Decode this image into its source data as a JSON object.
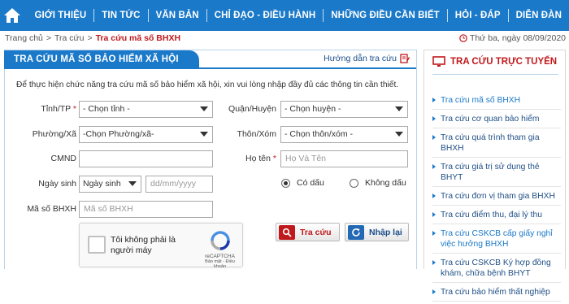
{
  "nav": {
    "items": [
      "GIỚI THIỆU",
      "TIN TỨC",
      "VĂN BẢN",
      "CHỈ ĐẠO - ĐIỀU HÀNH",
      "NHỮNG ĐIỀU CẦN BIẾT",
      "HỎI - ĐÁP",
      "DIỄN ĐÀN"
    ]
  },
  "breadcrumb": {
    "home": "Trang chủ",
    "parent": "Tra cứu",
    "current": "Tra cứu mã số BHXH"
  },
  "date_text": "Thứ ba, ngày 08/09/2020",
  "panel": {
    "title": "TRA CỨU MÃ SỐ BẢO HIỂM XÃ HỘI",
    "guide_label": "Hướng dẫn tra cứu",
    "intro": "Để thực hiện chức năng tra cứu mã số bảo hiểm xã hội, xin vui lòng nhập đầy đủ các thông tin cần thiết."
  },
  "form": {
    "province_label": "Tỉnh/TP",
    "province_value": "- Chọn tỉnh -",
    "district_label": "Quận/Huyện",
    "district_value": "- Chọn huyện -",
    "ward_label": "Phường/Xã",
    "ward_value": "-Chọn Phường/xã-",
    "village_label": "Thôn/Xóm",
    "village_value": "- Chọn thôn/xóm -",
    "cmnd_label": "CMND",
    "cmnd_value": "",
    "name_label": "Họ tên",
    "name_placeholder": "Họ Và Tên",
    "dob_label": "Ngày sinh",
    "dob_type_value": "Ngày sinh",
    "dob_placeholder": "dd/mm/yyyy",
    "accent_on": "Có dấu",
    "accent_off": "Không dấu",
    "bhxh_label": "Mã số BHXH",
    "bhxh_placeholder": "Mã số BHXH",
    "required_mark": "*"
  },
  "captcha": {
    "text": "Tôi không phải là người máy",
    "brand": "reCAPTCHA",
    "terms": "Bảo mật - Điều khoản"
  },
  "buttons": {
    "search": "Tra cứu",
    "reset": "Nhập lại"
  },
  "sidebar": {
    "title": "TRA CỨU TRỰC TUYẾN",
    "items": [
      "Tra cứu mã số BHXH",
      "Tra cứu cơ quan bảo hiểm",
      "Tra cứu quá trình tham gia BHXH",
      "Tra cứu giá trị sử dụng thẻ BHYT",
      "Tra cứu đơn vị tham gia BHXH",
      "Tra cứu điểm thu, đại lý thu",
      "Tra cứu CSKCB cấp giấy nghỉ việc hưởng BHXH",
      "Tra cứu CSKCB Ký hợp đồng khám, chữa bệnh BHYT",
      "Tra cứu bảo hiểm thất nghiệp"
    ]
  },
  "colors": {
    "brand_blue": "#1a79c9",
    "accent_red": "#c0191c",
    "link_blue": "#1f4f86"
  }
}
